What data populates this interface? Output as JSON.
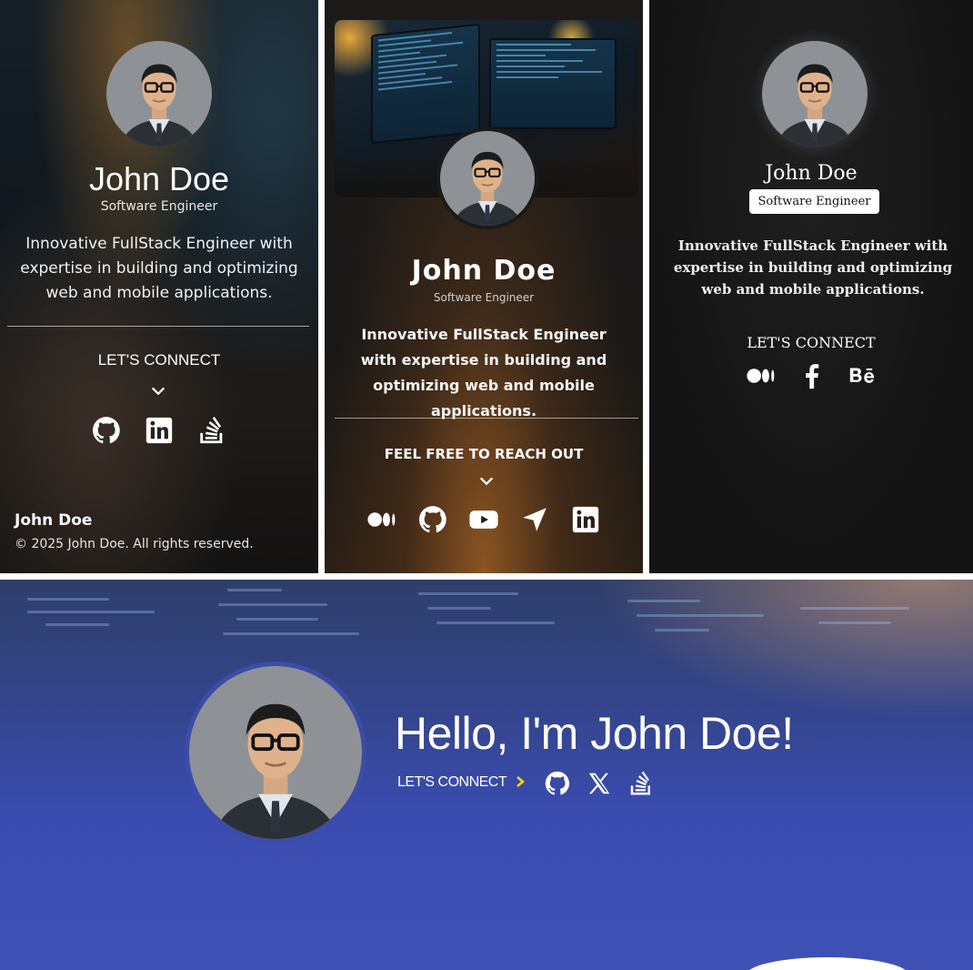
{
  "card1": {
    "name": "John Doe",
    "role": "Software Engineer",
    "bio": "Innovative FullStack Engineer with expertise in building and optimizing web and mobile applications.",
    "connect_label": "LET'S CONNECT",
    "social_icons": [
      "github-icon",
      "linkedin-icon",
      "stackoverflow-icon"
    ],
    "footer_name": "John Doe",
    "copyright": "© 2025 John Doe. All rights reserved."
  },
  "card2": {
    "name": "John Doe",
    "role": "Software Engineer",
    "bio": "Innovative FullStack Engineer with expertise in building and optimizing web and mobile applications.",
    "connect_label": "FEEL FREE TO REACH OUT",
    "social_icons": [
      "medium-icon",
      "github-icon",
      "youtube-icon",
      "navigation-icon",
      "linkedin-icon"
    ]
  },
  "card3": {
    "name": "John Doe",
    "role": "Software Engineer",
    "bio": "Innovative FullStack Engineer with expertise in building and optimizing web and mobile applications.",
    "connect_label": "LET'S CONNECT",
    "social_icons": [
      "medium-icon",
      "facebook-icon",
      "behance-icon"
    ]
  },
  "hero": {
    "title": "Hello, I'm John Doe!",
    "connect_label": "LET'S CONNECT",
    "social_icons": [
      "github-icon",
      "x-icon",
      "stackoverflow-icon"
    ]
  },
  "colors": {
    "hero_blue": "#3f51b5",
    "connect_arrow": "#f5d90a",
    "card3_bg": "#141414"
  }
}
